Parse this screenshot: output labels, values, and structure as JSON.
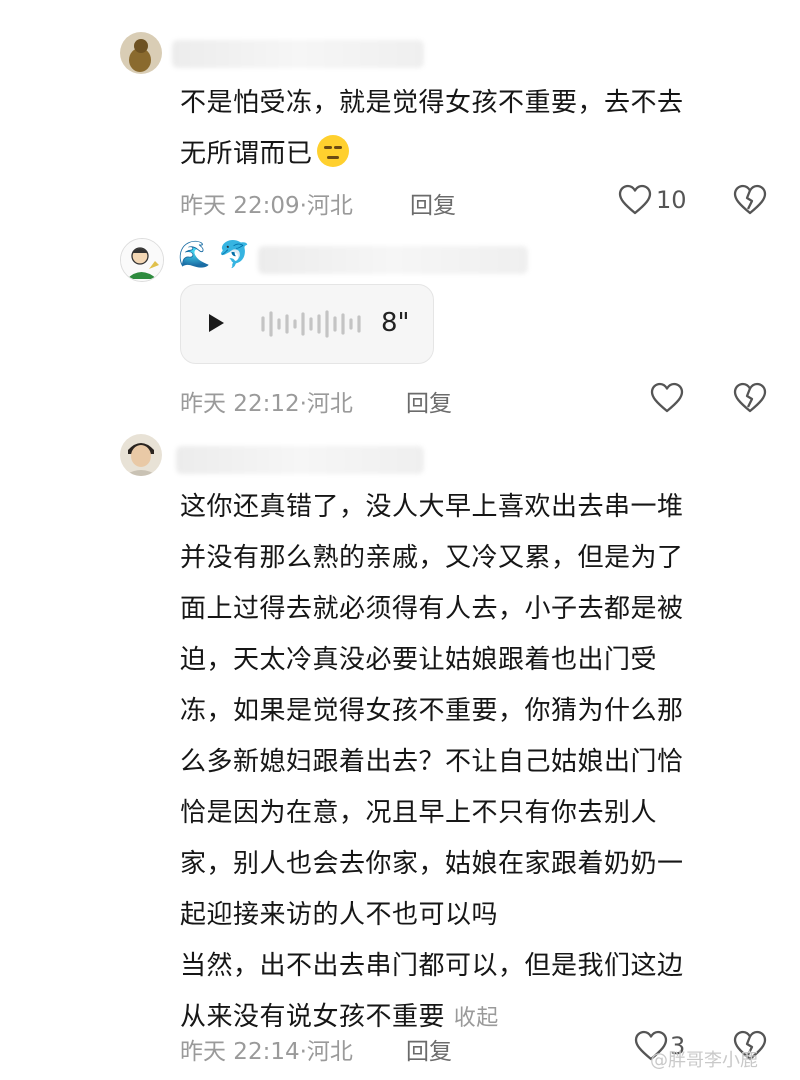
{
  "comments": [
    {
      "text_lines": [
        "不是怕受冻，就是觉得女孩不重要，去不去",
        "无所谓而已"
      ],
      "emoji": "expressionless-face",
      "time": "昨天 22:09",
      "location": "河北",
      "reply_label": "回复",
      "likes": "10"
    },
    {
      "name_emojis": [
        "🌊",
        "🐬"
      ],
      "voice_duration": "8\"",
      "time": "昨天 22:12",
      "location": "河北",
      "reply_label": "回复"
    },
    {
      "text_lines": [
        "这你还真错了，没人大早上喜欢出去串一堆",
        "并没有那么熟的亲戚，又冷又累，但是为了",
        "面上过得去就必须得有人去，小子去都是被",
        "迫，天太冷真没必要让姑娘跟着也出门受",
        "冻，如果是觉得女孩不重要，你猜为什么那",
        "么多新媳妇跟着出去？不让自己姑娘出门恰",
        "恰是因为在意，况且早上不只有你去别人",
        "家，别人也会去你家，姑娘在家跟着奶奶一",
        "起迎接来访的人不也可以吗",
        "当然，出不出去串门都可以，但是我们这边",
        "从来没有说女孩不重要"
      ],
      "collapse_label": "收起",
      "time": "昨天 22:14",
      "location": "河北",
      "reply_label": "回复",
      "likes": "3"
    }
  ],
  "watermark": "@胖哥李小鹿",
  "colors": {
    "meta": "#9a9a9a",
    "text": "#161616"
  }
}
